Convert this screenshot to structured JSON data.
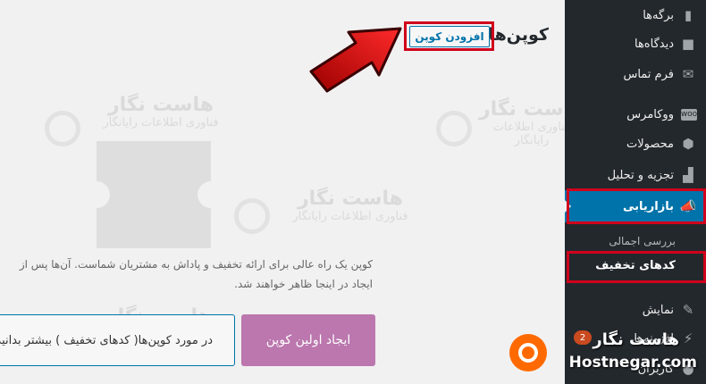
{
  "page": {
    "title": "کوپن‌ها",
    "add_button": "افزودن کوپن"
  },
  "empty_state": {
    "description": "کوپن یک راه عالی برای ارائه تخفیف و پاداش به مشتریان شماست. آن‌ها پس از ایجاد در اینجا ظاهر خواهند شد.",
    "create_button": "ایجاد اولین کوپن",
    "learn_button": "در مورد کوپن‌ها( کدهای تخفیف ) بیشتر بدانید"
  },
  "sidebar": {
    "items": [
      {
        "label": "برگه‌ها",
        "icon": "pages-icon"
      },
      {
        "label": "دیدگاه‌ها",
        "icon": "comments-icon"
      },
      {
        "label": "فرم تماس",
        "icon": "mail-icon"
      },
      {
        "label": "ووکامرس",
        "icon": "woo-icon"
      },
      {
        "label": "محصولات",
        "icon": "box-icon"
      },
      {
        "label": "تجزیه و تحلیل",
        "icon": "chart-icon"
      },
      {
        "label": "بازاریابی",
        "icon": "megaphone-icon"
      },
      {
        "label": "نمایش",
        "icon": "brush-icon"
      },
      {
        "label": "افزونه‌ها",
        "icon": "plugin-icon"
      },
      {
        "label": "کاربران",
        "icon": "user-icon"
      }
    ],
    "submenu": {
      "overview": "بررسی اجمالی",
      "coupons": "کدهای تخفیف"
    },
    "plugins_badge": "2"
  },
  "watermark": {
    "brand": "هاست نگار",
    "tagline": "فناوری اطلاعات رایانگار"
  },
  "logo": {
    "fa": "هاست نگار",
    "en": "Hostnegar.com"
  },
  "colors": {
    "sidebar_bg": "#23282d",
    "active": "#0073aa",
    "accent_red": "#d0021b",
    "create_button": "#bb77ae",
    "logo_orange": "#ff6a00"
  }
}
